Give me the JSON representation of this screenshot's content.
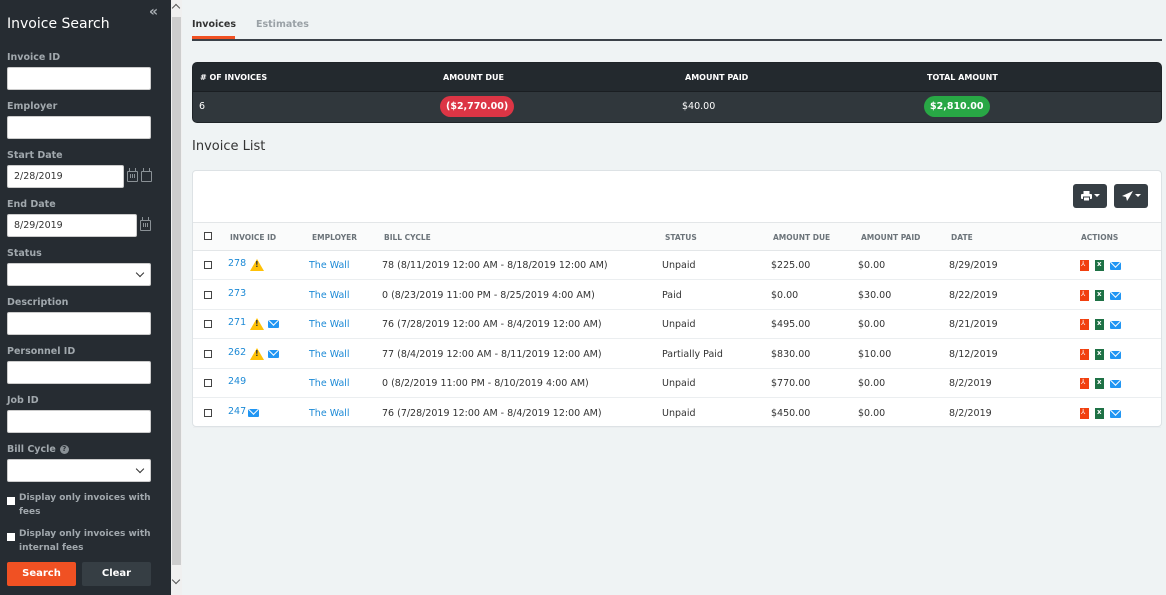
{
  "sidebar": {
    "title": "Invoice Search",
    "collapse_icon": "double-chevron-left",
    "fields": {
      "invoice_id": {
        "label": "Invoice ID",
        "value": ""
      },
      "employer": {
        "label": "Employer",
        "value": ""
      },
      "start_date": {
        "label": "Start Date",
        "value": "2/28/2019"
      },
      "end_date": {
        "label": "End Date",
        "value": "8/29/2019"
      },
      "status": {
        "label": "Status",
        "value": ""
      },
      "description": {
        "label": "Description",
        "value": ""
      },
      "personnel_id": {
        "label": "Personnel ID",
        "value": ""
      },
      "job_id": {
        "label": "Job ID",
        "value": ""
      },
      "bill_cycle": {
        "label": "Bill Cycle",
        "value": "",
        "help": "?"
      }
    },
    "checkboxes": [
      {
        "label": "Display only invoices with fees",
        "checked": false
      },
      {
        "label": "Display only invoices with internal fees",
        "checked": false
      }
    ],
    "search_label": "Search",
    "clear_label": "Clear"
  },
  "tabs": [
    {
      "label": "Invoices",
      "active": true
    },
    {
      "label": "Estimates",
      "active": false
    }
  ],
  "summary": {
    "headers": [
      "# OF INVOICES",
      "AMOUNT DUE",
      "AMOUNT PAID",
      "TOTAL AMOUNT"
    ],
    "count": "6",
    "amount_due": "($2,770.00)",
    "amount_paid": "$40.00",
    "total_amount": "$2,810.00",
    "colors": {
      "due": "#dc3545",
      "total": "#28a745"
    }
  },
  "list_title": "Invoice List",
  "toolbar": {
    "print_icon": "print-icon",
    "send_icon": "paper-plane-icon"
  },
  "table": {
    "headers": [
      "INVOICE ID",
      "EMPLOYER",
      "BILL CYCLE",
      "STATUS",
      "AMOUNT DUE",
      "AMOUNT PAID",
      "DATE",
      "ACTIONS"
    ],
    "rows": [
      {
        "id": "278",
        "warn": true,
        "mail": false,
        "employer": "The Wall",
        "bill_cycle": "78 (8/11/2019 12:00 AM - 8/18/2019 12:00 AM)",
        "status": "Unpaid",
        "amount_due": "$225.00",
        "amount_paid": "$0.00",
        "date": "8/29/2019"
      },
      {
        "id": "273",
        "warn": false,
        "mail": false,
        "employer": "The Wall",
        "bill_cycle": "0 (8/23/2019 11:00 PM - 8/25/2019 4:00 AM)",
        "status": "Paid",
        "amount_due": "$0.00",
        "amount_paid": "$30.00",
        "date": "8/22/2019"
      },
      {
        "id": "271",
        "warn": true,
        "mail": true,
        "employer": "The Wall",
        "bill_cycle": "76 (7/28/2019 12:00 AM - 8/4/2019 12:00 AM)",
        "status": "Unpaid",
        "amount_due": "$495.00",
        "amount_paid": "$0.00",
        "date": "8/21/2019"
      },
      {
        "id": "262",
        "warn": true,
        "mail": true,
        "employer": "The Wall",
        "bill_cycle": "77 (8/4/2019 12:00 AM - 8/11/2019 12:00 AM)",
        "status": "Partially Paid",
        "amount_due": "$830.00",
        "amount_paid": "$10.00",
        "date": "8/12/2019"
      },
      {
        "id": "249",
        "warn": false,
        "mail": false,
        "employer": "The Wall",
        "bill_cycle": "0 (8/2/2019 11:00 PM - 8/10/2019 4:00 AM)",
        "status": "Unpaid",
        "amount_due": "$770.00",
        "amount_paid": "$0.00",
        "date": "8/2/2019"
      },
      {
        "id": "247",
        "warn": false,
        "mail": true,
        "employer": "The Wall",
        "bill_cycle": "76 (7/28/2019 12:00 AM - 8/4/2019 12:00 AM)",
        "status": "Unpaid",
        "amount_due": "$450.00",
        "amount_paid": "$0.00",
        "date": "8/2/2019"
      }
    ]
  }
}
